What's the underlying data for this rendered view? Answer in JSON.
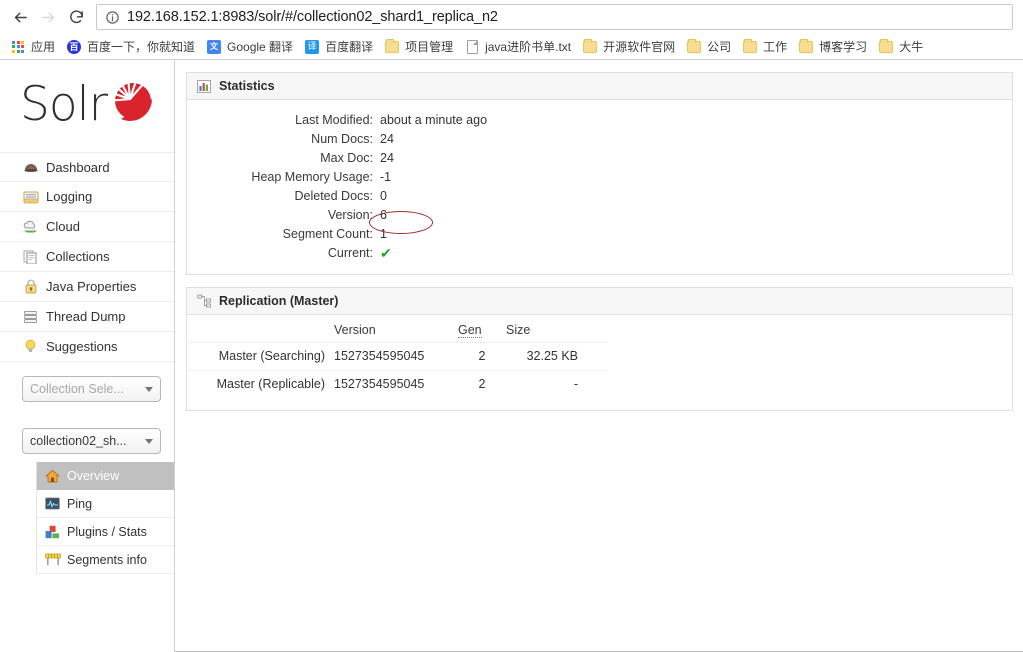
{
  "browser": {
    "back_label": "Back",
    "forward_label": "Forward",
    "reload_label": "Reload",
    "info_label": "Site information",
    "url": "192.168.152.1:8983/solr/#/collection02_shard1_replica_n2",
    "bookmarks": [
      {
        "label": "应用",
        "icon": "apps-grid-icon"
      },
      {
        "label": "百度一下，你就知道",
        "icon": "baidu-icon"
      },
      {
        "label": "Google 翻译",
        "icon": "google-translate-icon"
      },
      {
        "label": "百度翻译",
        "icon": "baidu-translate-icon"
      },
      {
        "label": "项目管理",
        "icon": "folder-icon"
      },
      {
        "label": "java进阶书单.txt",
        "icon": "document-icon"
      },
      {
        "label": "开源软件官网",
        "icon": "folder-icon"
      },
      {
        "label": "公司",
        "icon": "folder-icon"
      },
      {
        "label": "工作",
        "icon": "folder-icon"
      },
      {
        "label": "博客学习",
        "icon": "folder-icon"
      },
      {
        "label": "大牛",
        "icon": "folder-icon"
      }
    ]
  },
  "sidebar": {
    "logo_text": "Solr",
    "nav_items": [
      {
        "label": "Dashboard",
        "icon": "dashboard-icon"
      },
      {
        "label": "Logging",
        "icon": "logging-icon"
      },
      {
        "label": "Cloud",
        "icon": "cloud-icon"
      },
      {
        "label": "Collections",
        "icon": "collections-icon"
      },
      {
        "label": "Java Properties",
        "icon": "java-properties-icon"
      },
      {
        "label": "Thread Dump",
        "icon": "thread-dump-icon"
      },
      {
        "label": "Suggestions",
        "icon": "suggestions-icon"
      }
    ],
    "collection_selector_placeholder": "Collection Sele...",
    "core_selector_value": "collection02_sh...",
    "sub_items": [
      {
        "label": "Overview",
        "icon": "home-icon",
        "active": true
      },
      {
        "label": "Ping",
        "icon": "ping-icon",
        "active": false
      },
      {
        "label": "Plugins / Stats",
        "icon": "plugins-icon",
        "active": false
      },
      {
        "label": "Segments info",
        "icon": "segments-icon",
        "active": false
      }
    ]
  },
  "statistics": {
    "title": "Statistics",
    "icon": "bar-chart-icon",
    "rows": [
      {
        "key": "Last Modified:",
        "value": "about a minute ago"
      },
      {
        "key": "Num Docs:",
        "value": "24"
      },
      {
        "key": "Max Doc:",
        "value": "24"
      },
      {
        "key": "Heap Memory Usage:",
        "value": "-1"
      },
      {
        "key": "Deleted Docs:",
        "value": "0"
      },
      {
        "key": "Version:",
        "value": "6"
      },
      {
        "key": "Segment Count:",
        "value": "1"
      },
      {
        "key": "Current:",
        "value": "✔"
      }
    ]
  },
  "replication": {
    "title": "Replication (Master)",
    "icon": "replication-icon",
    "headers": {
      "label": "",
      "version": "Version",
      "gen": "Gen",
      "size": "Size"
    },
    "rows": [
      {
        "label": "Master (Searching)",
        "version": "1527354595045",
        "gen": "2",
        "size": "32.25 KB"
      },
      {
        "label": "Master (Replicable)",
        "version": "1527354595045",
        "gen": "2",
        "size": "-"
      }
    ]
  },
  "annotation": {
    "type": "red-ellipse",
    "target": "Num Docs value",
    "color": "#9e2b2b"
  }
}
